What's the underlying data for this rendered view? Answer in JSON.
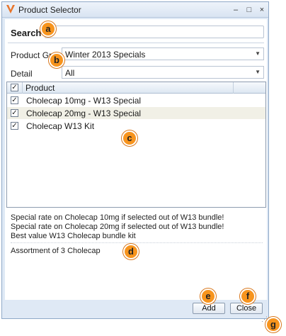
{
  "window": {
    "title": "Product Selector",
    "minimize_label": "–",
    "maximize_label": "□",
    "close_label": "×"
  },
  "search": {
    "label": "Search",
    "value": "",
    "placeholder": ""
  },
  "product_group": {
    "label": "Product Group",
    "value": "Winter 2013 Specials"
  },
  "detail": {
    "label": "Detail",
    "value": "All"
  },
  "grid": {
    "header_check": "✓",
    "header_product": "Product",
    "rows": [
      {
        "check": "✓",
        "label": "Cholecap 10mg - W13 Special"
      },
      {
        "check": "✓",
        "label": "Cholecap 20mg - W13 Special"
      },
      {
        "check": "✓",
        "label": "Cholecap W13 Kit"
      }
    ]
  },
  "description": {
    "lines": [
      "Special rate on Cholecap 10mg if selected out of W13 bundle!",
      "Special rate on Cholecap 20mg if selected out of W13 bundle!",
      "Best value W13 Cholecap bundle kit",
      "Assortment of 3 Cholecap"
    ]
  },
  "buttons": {
    "add": "Add",
    "close": "Close"
  },
  "callouts": {
    "a": "a",
    "b": "b",
    "c": "c",
    "d": "d",
    "e": "e",
    "f": "f",
    "g": "g"
  },
  "colors": {
    "accent": "#f7941d",
    "chrome": "#dfe9f5",
    "row_alt": "#f1f0e6"
  }
}
